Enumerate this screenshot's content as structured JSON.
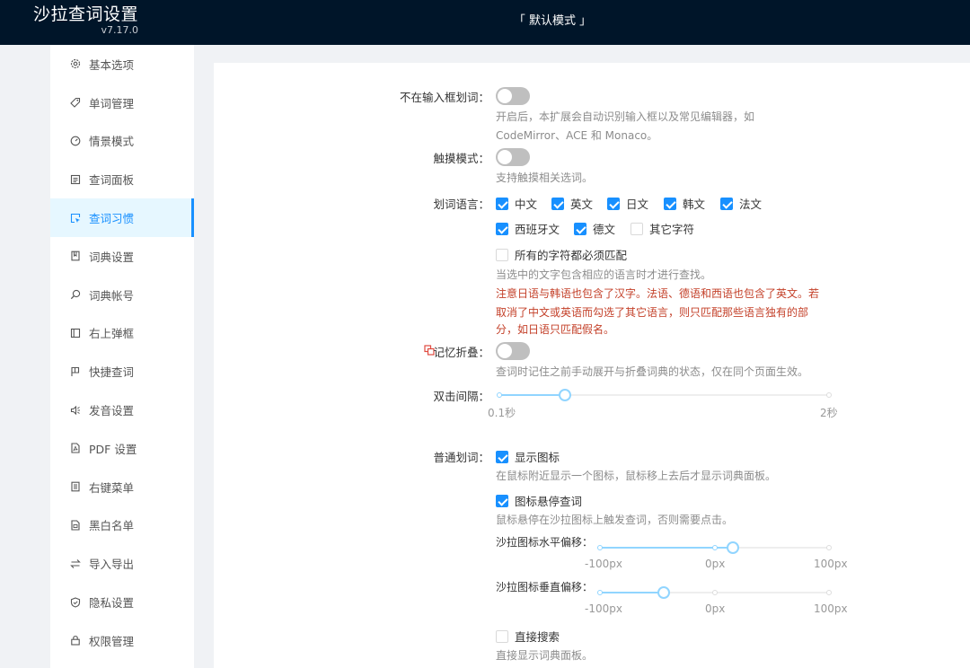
{
  "app": {
    "title": "沙拉查词设置",
    "version": "v7.17.0",
    "mode": "「 默认模式 」"
  },
  "sidebar": {
    "items": [
      {
        "label": "基本选项",
        "icon": "gear-icon"
      },
      {
        "label": "单词管理",
        "icon": "tag-icon"
      },
      {
        "label": "情景模式",
        "icon": "dashboard-icon"
      },
      {
        "label": "查词面板",
        "icon": "panel-icon"
      },
      {
        "label": "查词习惯",
        "icon": "select-icon",
        "active": true
      },
      {
        "label": "词典设置",
        "icon": "book-icon"
      },
      {
        "label": "词典帐号",
        "icon": "search-icon"
      },
      {
        "label": "右上弹框",
        "icon": "layout-icon"
      },
      {
        "label": "快捷查词",
        "icon": "flag-icon"
      },
      {
        "label": "发音设置",
        "icon": "sound-icon"
      },
      {
        "label": "PDF 设置",
        "icon": "pdf-icon"
      },
      {
        "label": "右键菜单",
        "icon": "menu-icon"
      },
      {
        "label": "黑白名单",
        "icon": "list-icon"
      },
      {
        "label": "导入导出",
        "icon": "swap-icon"
      },
      {
        "label": "隐私设置",
        "icon": "shield-icon"
      },
      {
        "label": "权限管理",
        "icon": "lock-icon"
      }
    ]
  },
  "settings": {
    "no_input_select": {
      "label": "不在输入框划词：",
      "enabled": false,
      "desc_line1": "开启后，本扩展会自动识别输入框以及常见编辑器，如",
      "desc_line2": "CodeMirror、ACE 和 Monaco。"
    },
    "touch_mode": {
      "label": "触摸模式：",
      "enabled": false,
      "desc": "支持触摸相关选词。"
    },
    "languages": {
      "label": "划词语言：",
      "options": [
        {
          "label": "中文",
          "checked": true
        },
        {
          "label": "英文",
          "checked": true
        },
        {
          "label": "日文",
          "checked": true
        },
        {
          "label": "韩文",
          "checked": true
        },
        {
          "label": "法文",
          "checked": true
        },
        {
          "label": "西班牙文",
          "checked": true
        },
        {
          "label": "德文",
          "checked": true
        },
        {
          "label": "其它字符",
          "checked": false
        }
      ],
      "match_all": {
        "label": "所有的字符都必须匹配",
        "checked": false
      },
      "desc": "当选中的文字包含相应的语言时才进行查找。",
      "warn_line1": "注意日语与韩语也包含了汉字。法语、德语和西语也包含了英文。若",
      "warn_line2": "取消了中文或英语而勾选了其它语言，则只匹配那些语言独有的部",
      "warn_line3": "分，如日语只匹配假名。"
    },
    "remember_fold": {
      "label": "记忆折叠：",
      "enabled": false,
      "desc": "查词时记住之前手动展开与折叠词典的状态，仅在同个页面生效。"
    },
    "double_click": {
      "label": "双击间隔：",
      "value_fraction": 0.2,
      "min_label": "0.1秒",
      "max_label": "2秒"
    },
    "normal_select": {
      "label": "普通划词：",
      "show_icon": {
        "label": "显示图标",
        "checked": true,
        "desc": "在鼠标附近显示一个图标，鼠标移上去后才显示词典面板。"
      },
      "hover_icon": {
        "label": "图标悬停查词",
        "checked": true,
        "desc": "鼠标悬停在沙拉图标上触发查词，否则需要点击。"
      },
      "h_offset": {
        "label": "沙拉图标水平偏移：",
        "value_fraction": 0.58,
        "marks": [
          "-100px",
          "0px",
          "100px"
        ]
      },
      "v_offset": {
        "label": "沙拉图标垂直偏移：",
        "value_fraction": 0.28,
        "marks": [
          "-100px",
          "0px",
          "100px"
        ]
      },
      "direct_search": {
        "label": "直接搜索",
        "checked": false,
        "desc": "直接显示词典面板。"
      }
    }
  },
  "colors": {
    "header": "#001529",
    "accent": "#1890ff",
    "warning": "#c4412a",
    "slider": "#91d5ff"
  }
}
